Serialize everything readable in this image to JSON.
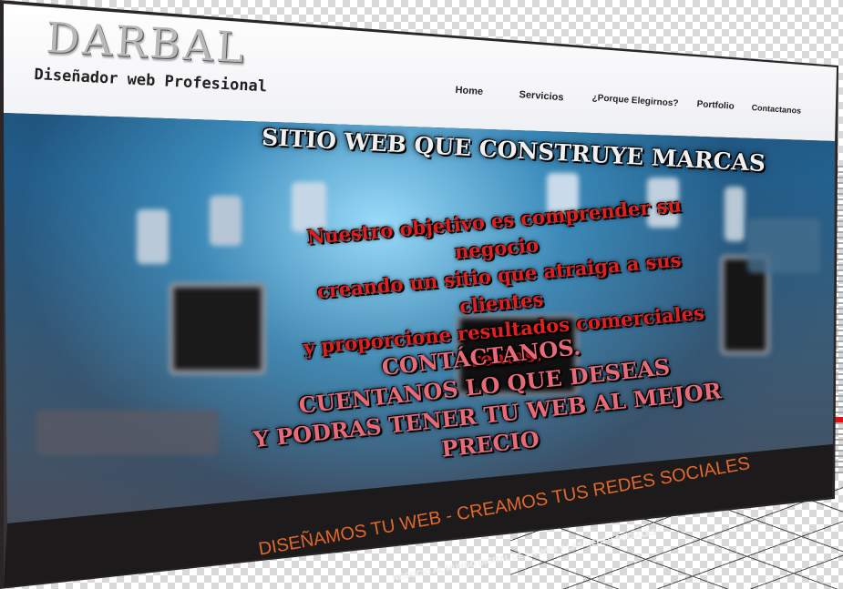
{
  "brand": {
    "logo": "DARBAL",
    "tagline": "Diseñador web Profesional"
  },
  "nav": {
    "items": [
      {
        "label": "Home"
      },
      {
        "label": "Servicios"
      },
      {
        "label": "¿Porque Elegirnos?"
      },
      {
        "label": "Portfolio"
      },
      {
        "label": "Contactanos"
      }
    ]
  },
  "hero": {
    "title": "SITIO WEB QUE CONSTRUYE MARCAS",
    "objective_lines": [
      "Nuestro objetivo es comprender su negocio",
      "creando un sitio que atraiga a sus clientes",
      "y proporcione resultados comerciales reales."
    ],
    "cta_lines": [
      "CONTÁCTANOS.",
      "CUENTANOS LO QUE DESEAS",
      "Y PODRAS TENER TU WEB AL MEJOR PRECIO"
    ]
  },
  "band": {
    "title": "DISEÑAMOS TU WEB - CREAMOS TUS REDES SOCIALES",
    "subtitle": "NEGOCIO AL MUNDO DIGITAL DE LA WEB Y LAS REDES SOCIALES"
  },
  "colors": {
    "hero_text_red": "#e02020",
    "cta_pink": "#e86a78",
    "band_orange": "#e2672b"
  }
}
